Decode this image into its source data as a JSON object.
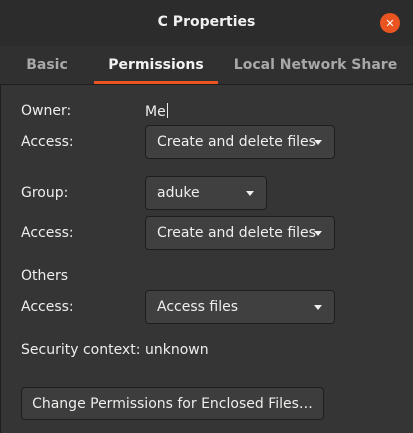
{
  "window": {
    "title": "C Properties"
  },
  "tabs": [
    {
      "label": "Basic",
      "active": false
    },
    {
      "label": "Permissions",
      "active": true
    },
    {
      "label": "Local Network Share",
      "active": false
    }
  ],
  "owner": {
    "label": "Owner:",
    "value": "Me"
  },
  "owner_access": {
    "label": "Access:",
    "selected": "Create and delete files"
  },
  "group": {
    "label": "Group:",
    "selected": "aduke"
  },
  "group_access": {
    "label": "Access:",
    "selected": "Create and delete files"
  },
  "others": {
    "heading": "Others"
  },
  "others_access": {
    "label": "Access:",
    "selected": "Access files"
  },
  "security": {
    "label": "Security context:",
    "value": "unknown"
  },
  "enclosed_button": {
    "label": "Change Permissions for Enclosed Files…"
  },
  "colors": {
    "accent": "#e95420",
    "background": "#303030",
    "combo": "#404040"
  },
  "icons": {
    "close": "close-icon",
    "dropdown": "chevron-down-icon"
  }
}
